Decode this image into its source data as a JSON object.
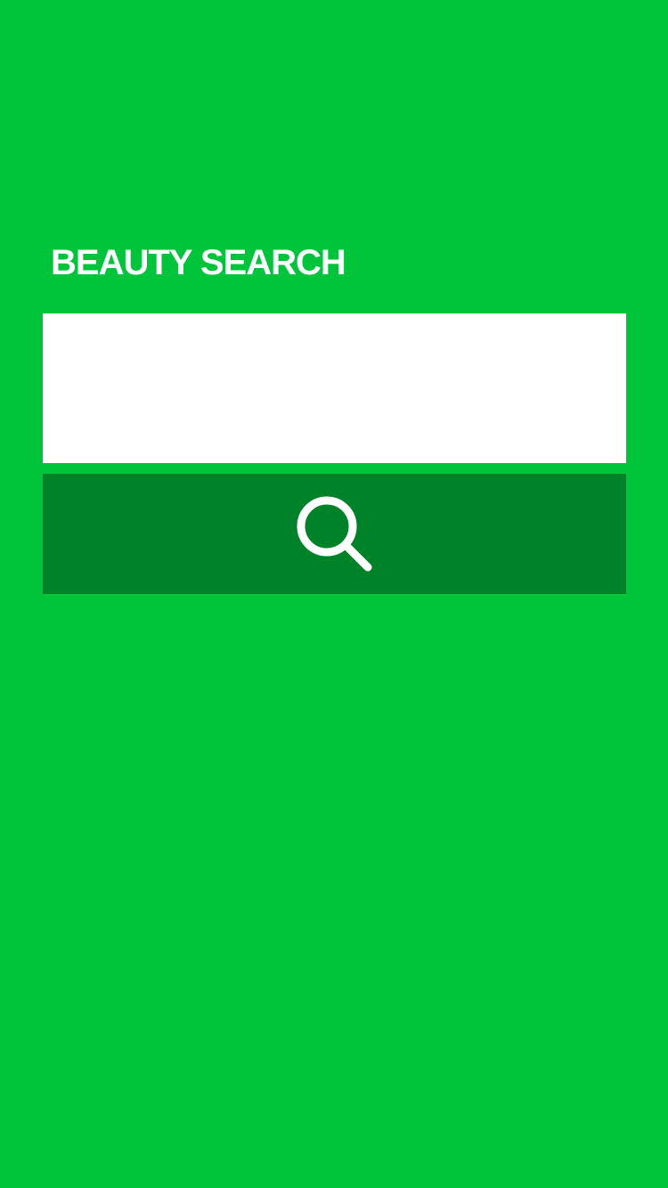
{
  "page": {
    "title": "BEAUTY SEARCH"
  },
  "search": {
    "value": "",
    "placeholder": "",
    "button_icon": "search-icon"
  },
  "colors": {
    "background": "#00C43A",
    "input_background": "#FFFFFF",
    "button_background": "#008229",
    "title_text": "#FFFFFF",
    "icon": "#FFFFFF"
  }
}
